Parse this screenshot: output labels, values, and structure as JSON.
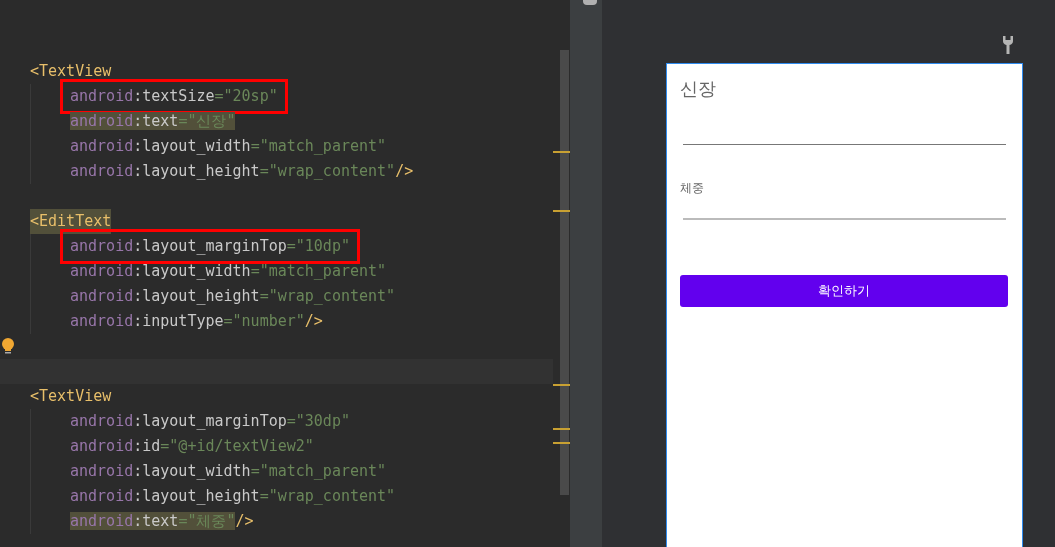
{
  "editor": {
    "lines": [
      {
        "kind": "blank"
      },
      {
        "kind": "tag",
        "text": "<TextView",
        "marked": false
      },
      {
        "kind": "attr",
        "prefix": "android",
        "name": ":textSize",
        "value": "=\"20sp\"",
        "boxed": true,
        "marked": false
      },
      {
        "kind": "attr",
        "prefix": "android",
        "name": ":text",
        "value": "=\"신장\"",
        "boxed": false,
        "marked": true
      },
      {
        "kind": "attr",
        "prefix": "android",
        "name": ":layout_width",
        "value": "=\"match_parent\"",
        "boxed": false,
        "marked": false
      },
      {
        "kind": "attr",
        "prefix": "android",
        "name": ":layout_height",
        "value": "=\"wrap_content\"",
        "end": "/>",
        "boxed": false,
        "marked": false
      },
      {
        "kind": "blank"
      },
      {
        "kind": "tag",
        "text": "<EditText",
        "marked": true
      },
      {
        "kind": "attr",
        "prefix": "android",
        "name": ":layout_marginTop",
        "value": "=\"10dp\"",
        "boxed": true,
        "marked": false
      },
      {
        "kind": "attr",
        "prefix": "android",
        "name": ":layout_width",
        "value": "=\"match_parent\"",
        "boxed": false,
        "marked": false
      },
      {
        "kind": "attr",
        "prefix": "android",
        "name": ":layout_height",
        "value": "=\"wrap_content\"",
        "boxed": false,
        "marked": false
      },
      {
        "kind": "attr",
        "prefix": "android",
        "name": ":inputType",
        "value": "=\"number\"",
        "end": "/>",
        "boxed": false,
        "marked": false
      },
      {
        "kind": "bulb"
      },
      {
        "kind": "current"
      },
      {
        "kind": "tag",
        "text": "<TextView",
        "marked": false
      },
      {
        "kind": "attr",
        "prefix": "android",
        "name": ":layout_marginTop",
        "value": "=\"30dp\"",
        "boxed": false,
        "marked": false
      },
      {
        "kind": "attr",
        "prefix": "android",
        "name": ":id",
        "value": "=\"@+id/textView2\"",
        "boxed": false,
        "marked": false
      },
      {
        "kind": "attr",
        "prefix": "android",
        "name": ":layout_width",
        "value": "=\"match_parent\"",
        "boxed": false,
        "marked": false
      },
      {
        "kind": "attr",
        "prefix": "android",
        "name": ":layout_height",
        "value": "=\"wrap_content\"",
        "boxed": false,
        "marked": false
      },
      {
        "kind": "attr",
        "prefix": "android",
        "name": ":text",
        "value": "=\"체중\"",
        "end": "/>",
        "boxed": false,
        "marked": true
      }
    ]
  },
  "preview": {
    "title_label": "신장",
    "weight_label": "체중",
    "button": "확인하기"
  }
}
